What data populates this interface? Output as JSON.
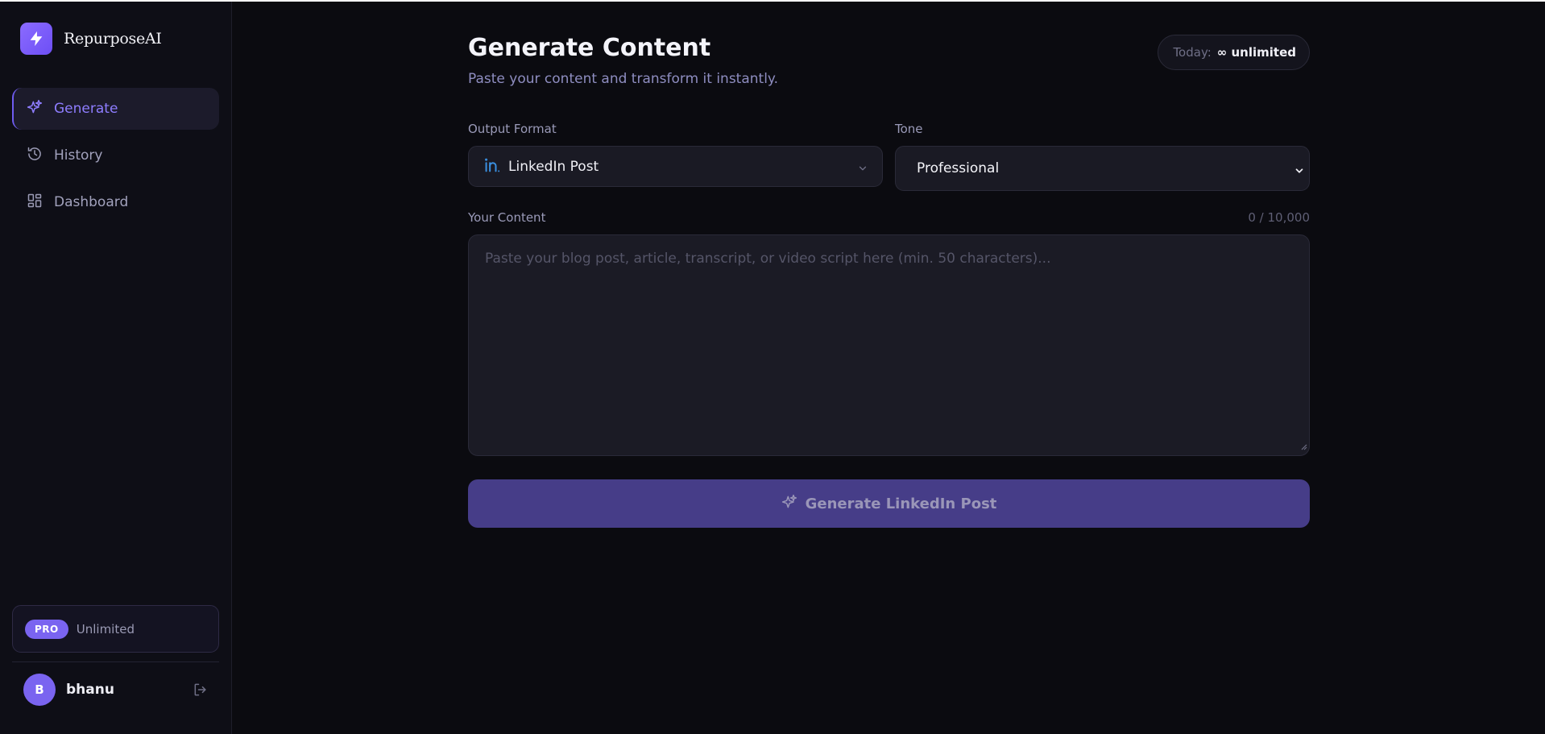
{
  "app": {
    "name": "RepurposeAI",
    "logo_icon": "lightning-bolt-icon",
    "accent_color": "#7a64f0"
  },
  "sidebar": {
    "items": [
      {
        "label": "Generate",
        "icon": "sparkles-icon",
        "active": true
      },
      {
        "label": "History",
        "icon": "history-clock-icon",
        "active": false
      },
      {
        "label": "Dashboard",
        "icon": "dashboard-grid-icon",
        "active": false
      }
    ],
    "plan": {
      "badge": "PRO",
      "text": "Unlimited"
    },
    "user": {
      "initial": "B",
      "name": "bhanu",
      "logout_icon": "logout-icon"
    }
  },
  "main": {
    "title": "Generate Content",
    "subtitle": "Paste your content and transform it instantly.",
    "usage": {
      "label": "Today:",
      "value": "∞ unlimited"
    },
    "output_format": {
      "label": "Output Format",
      "value": "LinkedIn Post",
      "icon": "linkedin-icon"
    },
    "tone": {
      "label": "Tone",
      "value": "Professional"
    },
    "content": {
      "label": "Your Content",
      "count": "0 / 10,000",
      "placeholder": "Paste your blog post, article, transcript, or video script here (min. 50 characters)...",
      "value": ""
    },
    "generate_button": {
      "label": "Generate LinkedIn Post",
      "icon": "sparkles-icon",
      "enabled": false
    }
  }
}
